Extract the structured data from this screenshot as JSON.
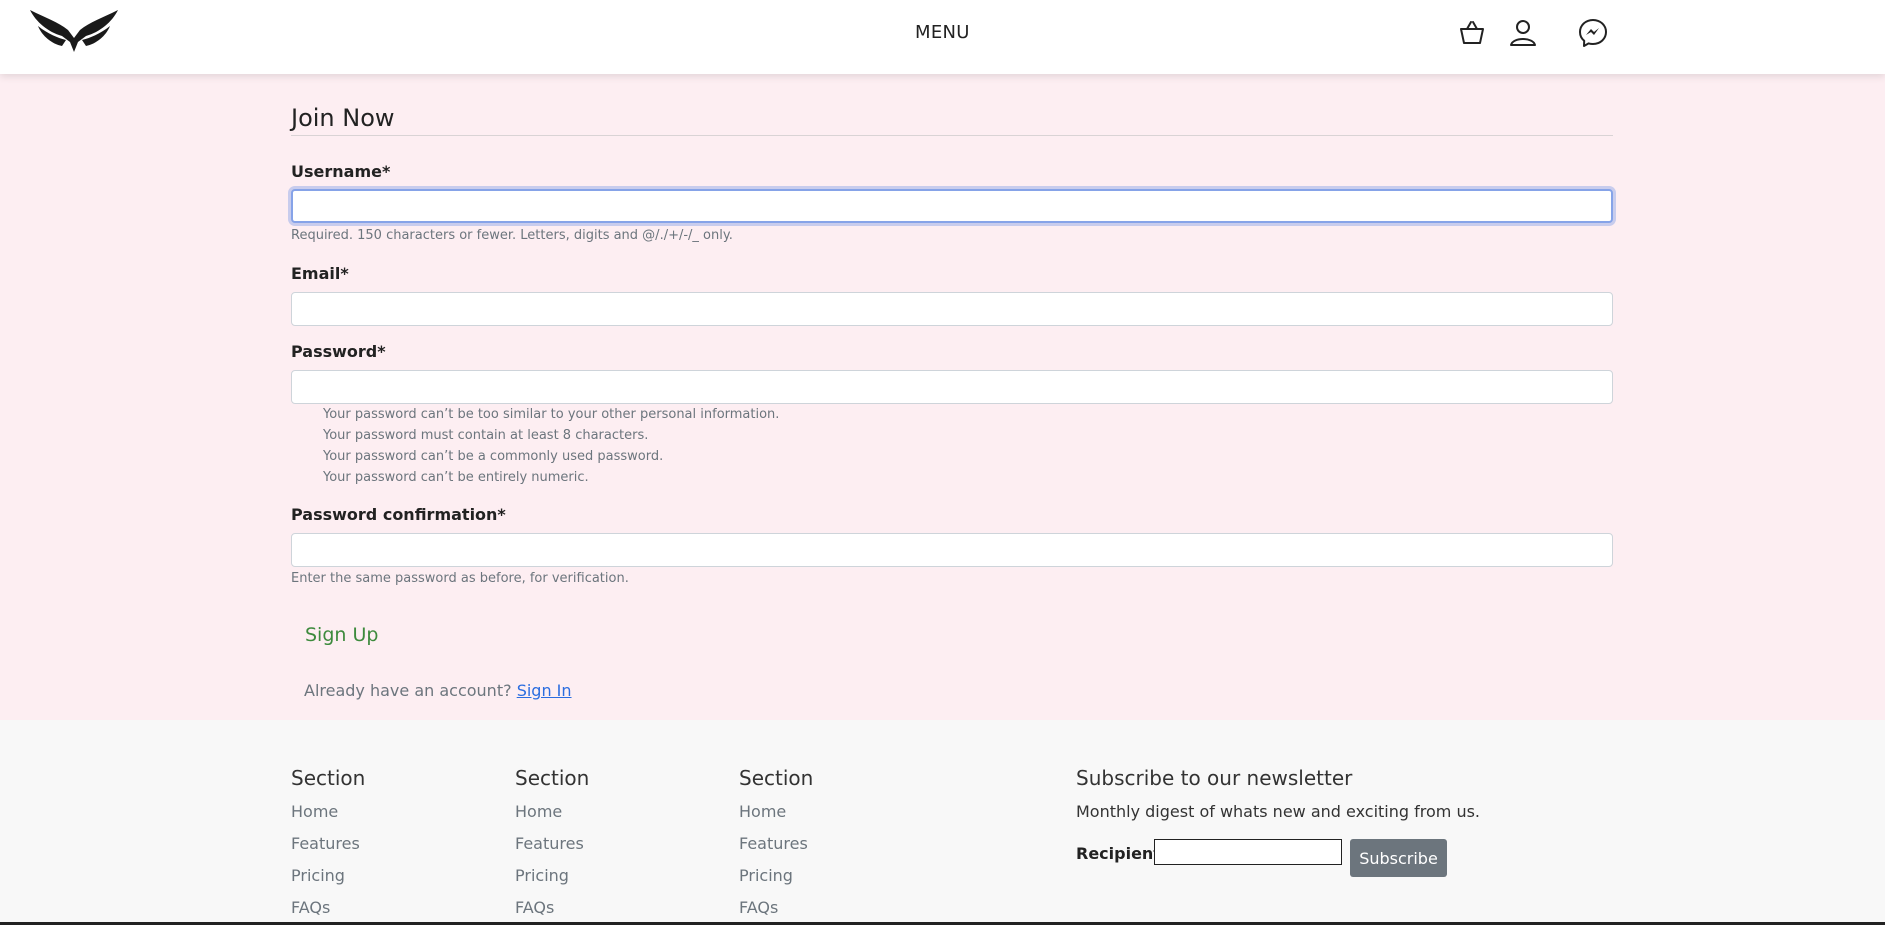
{
  "header": {
    "menu_label": "MENU",
    "icons": [
      "eagle-logo",
      "basket-icon",
      "user-icon",
      "messenger-icon"
    ]
  },
  "form": {
    "title": "Join Now",
    "username": {
      "label": "Username*",
      "value": "",
      "help": "Required. 150 characters or fewer. Letters, digits and @/./+/-/_ only."
    },
    "email": {
      "label": "Email*",
      "value": ""
    },
    "password": {
      "label": "Password*",
      "value": "",
      "help": [
        "Your password can’t be too similar to your other personal information.",
        "Your password must contain at least 8 characters.",
        "Your password can’t be a commonly used password.",
        "Your password can’t be entirely numeric."
      ]
    },
    "password_confirm": {
      "label": "Password confirmation*",
      "value": "",
      "help": "Enter the same password as before, for verification."
    },
    "submit_label": "Sign Up",
    "account_prompt": "Already have an account?",
    "signin_link": "Sign In"
  },
  "footer": {
    "sections": [
      {
        "title": "Section",
        "links": [
          "Home",
          "Features",
          "Pricing",
          "FAQs"
        ]
      },
      {
        "title": "Section",
        "links": [
          "Home",
          "Features",
          "Pricing",
          "FAQs"
        ]
      },
      {
        "title": "Section",
        "links": [
          "Home",
          "Features",
          "Pricing",
          "FAQs"
        ]
      }
    ],
    "newsletter": {
      "title": "Subscribe to our newsletter",
      "description": "Monthly digest of whats new and exciting from us.",
      "recipient_label": "Recipient:",
      "subscribe_label": "Subscribe"
    }
  },
  "colors": {
    "page_bg": "#fdeef2",
    "footer_bg": "#f8f8f8",
    "signup_green": "#3d8a3d",
    "link_blue": "#2b6de0",
    "button_gray": "#6c757d"
  }
}
